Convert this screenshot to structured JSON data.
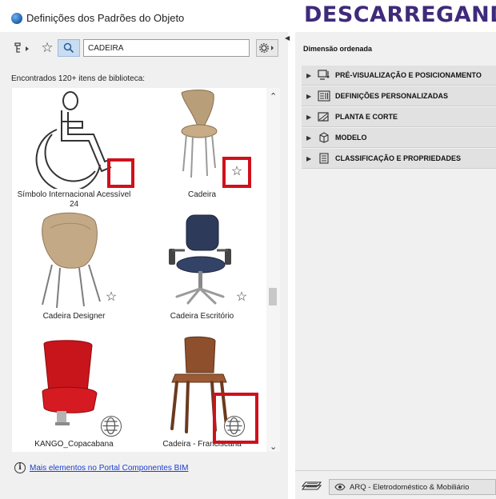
{
  "window": {
    "title": "Definições dos Padrões do Objeto",
    "overlay_banner": "DESCARREGAND"
  },
  "toolbar": {
    "search_value": "CADEIRA"
  },
  "library": {
    "found_label": "Encontrados 120+ itens de biblioteca:",
    "items": [
      {
        "label": "Símbolo Internacional Acessível 24",
        "icon": "accessibility-symbol",
        "marker": "none",
        "highlighted": true
      },
      {
        "label": "Cadeira",
        "icon": "chair-wood-bent",
        "marker": "star",
        "highlighted": true
      },
      {
        "label": "Cadeira Designer",
        "icon": "chair-designer",
        "marker": "star",
        "highlighted": false
      },
      {
        "label": "Cadeira Escritório",
        "icon": "chair-office",
        "marker": "star",
        "highlighted": false
      },
      {
        "label": "KANGO_Copacabana",
        "icon": "stadium-seat-red",
        "marker": "globe",
        "highlighted": false
      },
      {
        "label": "Cadeira - Franciscana",
        "icon": "chair-wood-classic",
        "marker": "globe",
        "highlighted": true
      }
    ],
    "bim_link": "Mais elementos no Portal Componentes BIM"
  },
  "settings": {
    "dimension_label": "Dimensão ordenada",
    "sections": [
      {
        "label": "PRÉ-VISUALIZAÇÃO E POSICIONAMENTO",
        "icon": "preview-icon"
      },
      {
        "label": "DEFINIÇÕES PERSONALIZADAS",
        "icon": "custom-settings-icon"
      },
      {
        "label": "PLANTA E CORTE",
        "icon": "plan-section-icon"
      },
      {
        "label": "MODELO",
        "icon": "model-cube-icon"
      },
      {
        "label": "CLASSIFICAÇÃO E PROPRIEDADES",
        "icon": "classification-icon"
      }
    ],
    "layer_value": "ARQ - Eletrodoméstico & Mobiliário"
  },
  "colors": {
    "banner": "#3f2a7a",
    "highlight_box": "#d0101c",
    "link": "#1a3fd0",
    "search_active": "#c9dcf0"
  }
}
